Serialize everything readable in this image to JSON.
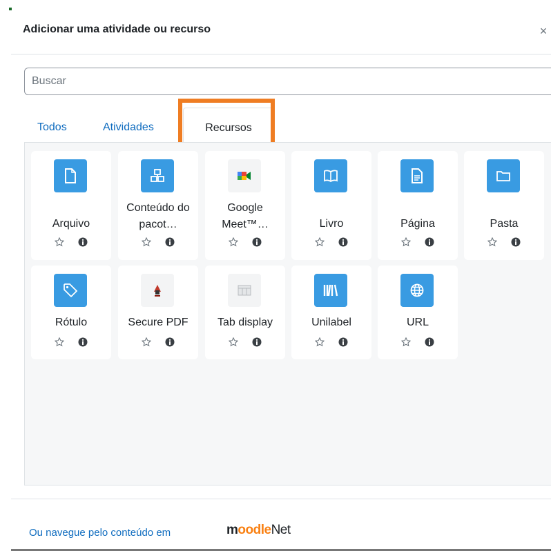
{
  "modal": {
    "title": "Adicionar uma atividade ou recurso",
    "close_label": "×"
  },
  "search": {
    "placeholder": "Buscar",
    "value": ""
  },
  "tabs": [
    {
      "label": "Todos",
      "active": false
    },
    {
      "label": "Atividades",
      "active": false
    },
    {
      "label": "Recursos",
      "active": true
    }
  ],
  "highlight_color": "#ef7d23",
  "accent_color": "#399be2",
  "link_color": "#0f6cbf",
  "items": [
    {
      "name": "Arquivo",
      "icon": "file-icon"
    },
    {
      "name": "Conteúdo do pacot…",
      "icon": "package-icon"
    },
    {
      "name": "Google Meet™…",
      "icon": "google-meet-icon"
    },
    {
      "name": "Livro",
      "icon": "book-icon"
    },
    {
      "name": "Página",
      "icon": "page-icon"
    },
    {
      "name": "Pasta",
      "icon": "folder-icon"
    },
    {
      "name": "Rótulo",
      "icon": "tag-icon"
    },
    {
      "name": "Secure PDF",
      "icon": "secure-pdf-icon"
    },
    {
      "name": "Tab display",
      "icon": "tab-display-icon"
    },
    {
      "name": "Unilabel",
      "icon": "unilabel-icon"
    },
    {
      "name": "URL",
      "icon": "globe-icon"
    }
  ],
  "footer": {
    "link_text": "Ou navegue pelo conteúdo em",
    "logo_part1": "m",
    "logo_part2": "oodle",
    "logo_part3": "Net"
  }
}
